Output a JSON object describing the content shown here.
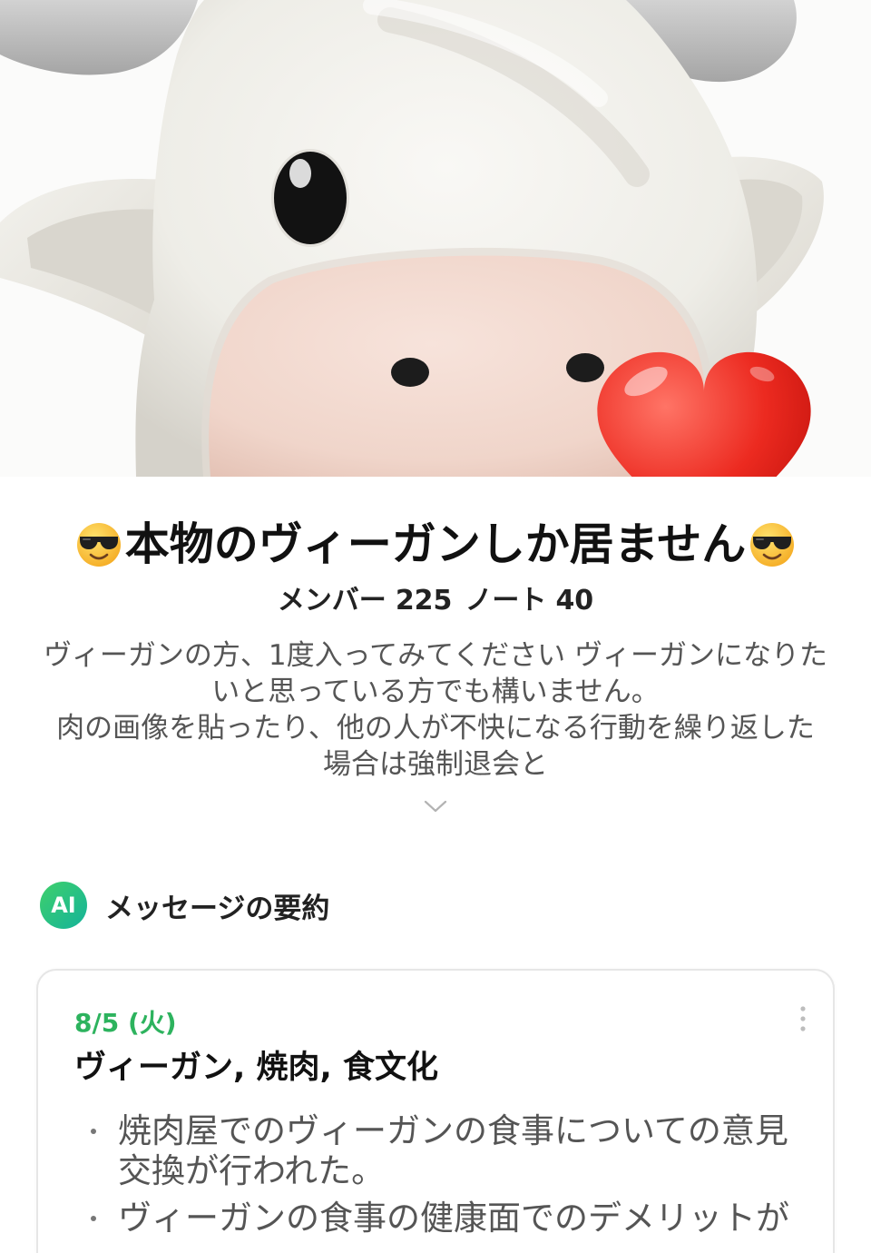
{
  "header": {
    "title": "本物のヴィーガンしか居ません",
    "title_prefix_icon": "smiling-face-with-sunglasses-icon",
    "title_suffix_icon": "smiling-face-with-sunglasses-icon",
    "members_label": "メンバー",
    "members_count": "225",
    "notes_label": "ノート",
    "notes_count": "40"
  },
  "description": {
    "lines": [
      "ヴィーガンの方、1度入ってみてください ヴィーガンになりた",
      "いと思っている方でも構いません。",
      "肉の画像を貼ったり、他の人が不快になる行動を繰り返した",
      "場合は強制退会と"
    ],
    "expand_icon": "chevron-down-icon"
  },
  "summary": {
    "badge": "AI",
    "heading": "メッセージの要約",
    "card": {
      "date": "8/5 (火)",
      "topics": "ヴィーガン, 焼肉, 食文化",
      "more_icon": "more-vertical-icon",
      "bullets": [
        {
          "lines": [
            "焼肉屋でのヴィーガンの食事についての意見",
            "交換が行われた。"
          ]
        },
        {
          "lines": [
            "ヴィーガンの食事の健康面でのデメリットが"
          ]
        }
      ]
    }
  },
  "colors": {
    "accent_green": "#2db35e",
    "ai_badge_start": "#3fd06b",
    "ai_badge_end": "#14b39a",
    "heart_red": "#e8231c",
    "text_primary": "#111111",
    "text_secondary": "#555555"
  }
}
